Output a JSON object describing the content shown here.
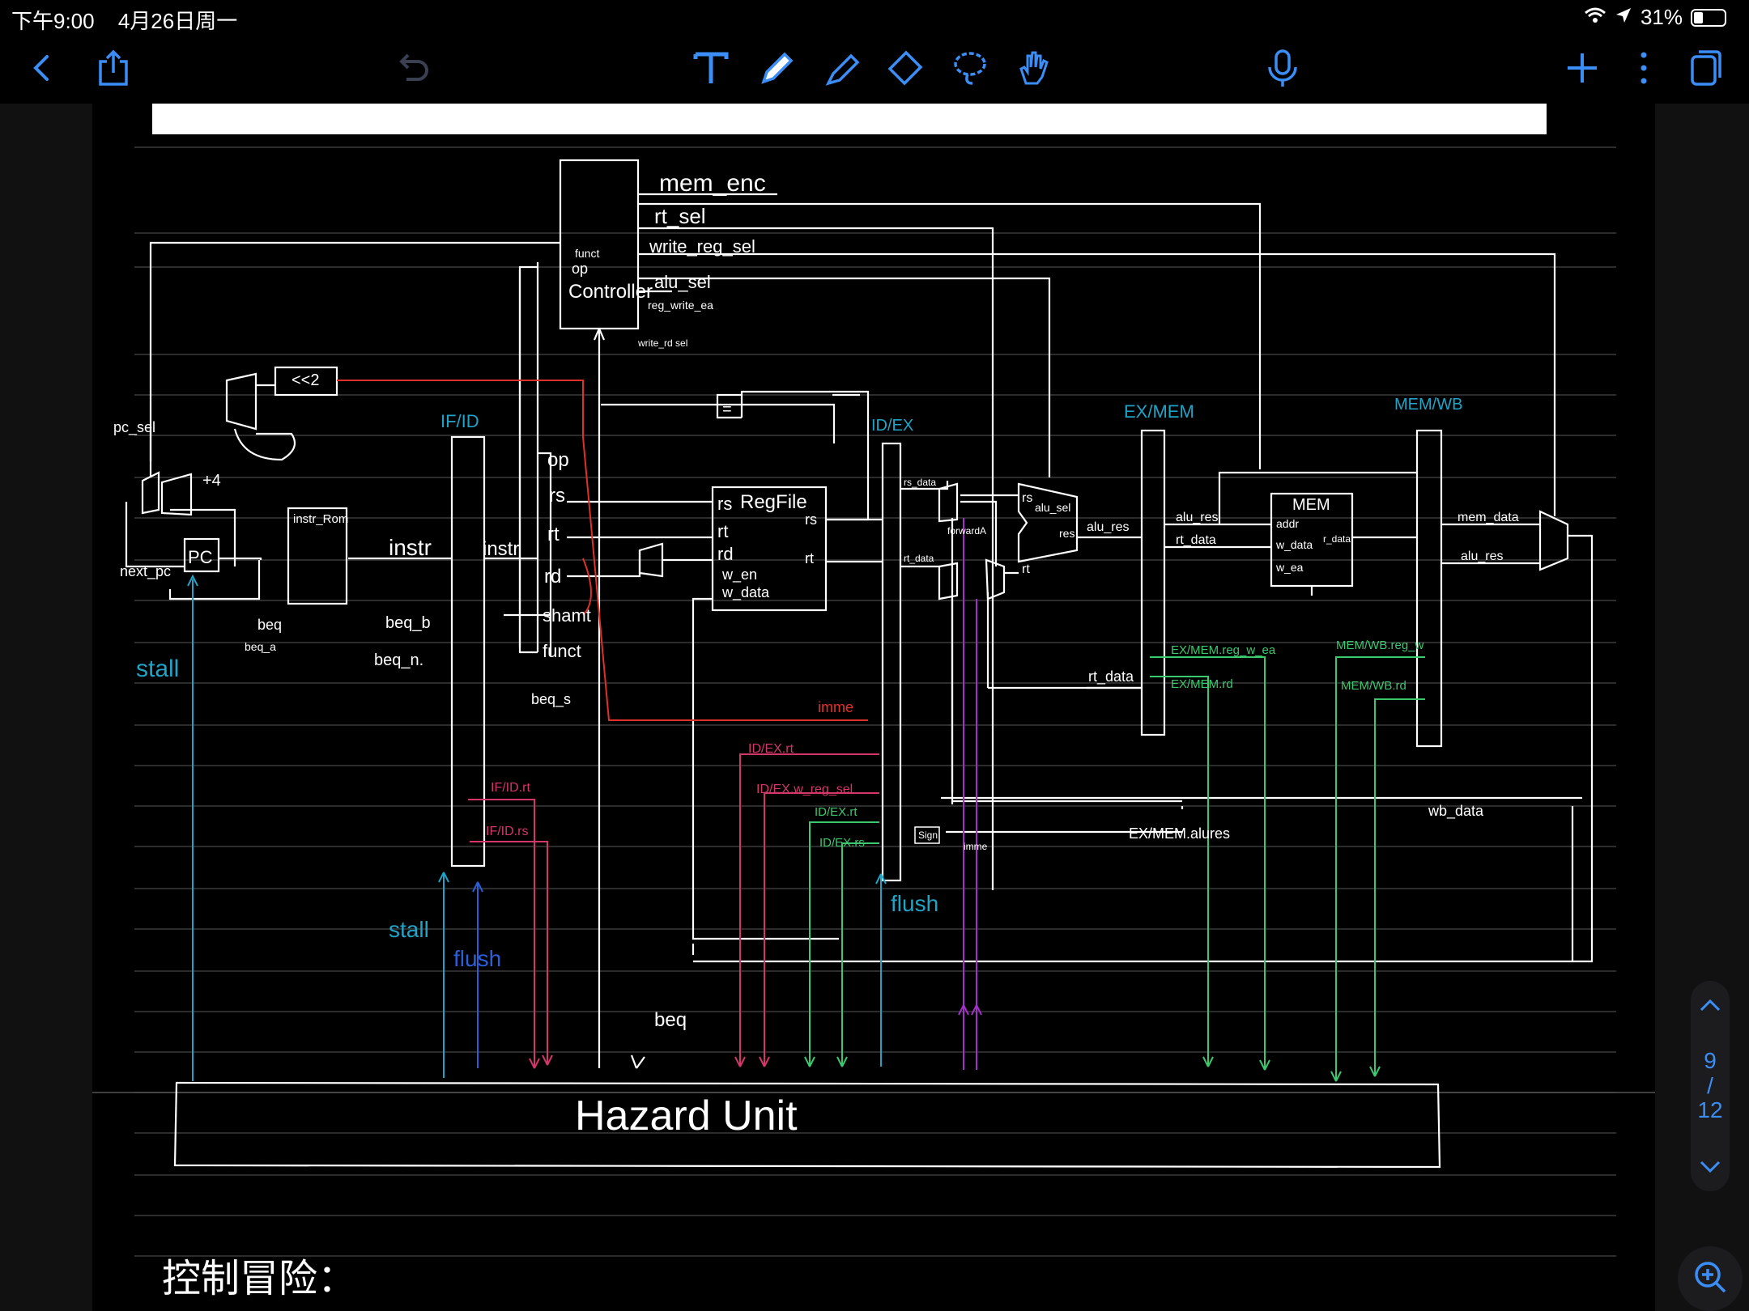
{
  "status": {
    "time": "下午9:00",
    "date": "4月26日周一",
    "battery": "31%",
    "battery_level": 0.31
  },
  "toolbar": {
    "icons": [
      "back-icon",
      "share-icon",
      "undo-icon",
      "text-tool-icon",
      "pen-icon",
      "highlighter-icon",
      "eraser-icon",
      "lasso-icon",
      "hand-icon",
      "mic-icon",
      "add-icon",
      "more-icon",
      "pages-icon"
    ]
  },
  "pager": {
    "current": "9",
    "sep": "/",
    "total": "12"
  },
  "colors": {
    "ink": "#ffffff",
    "cyan": "#1fa3c6",
    "red": "#e0302a",
    "pink": "#d2366b",
    "green": "#3cc86e",
    "purple": "#a330c8",
    "blue": "#2a5fd8",
    "accent": "#3a8ef6"
  },
  "diagram": {
    "controller": [
      "funct",
      "op",
      "Controller"
    ],
    "ctrl_signals": [
      "mem_enc",
      "rt_sel",
      "write_reg_sel",
      "alu_sel",
      "reg_write_ea",
      "write_rd sel"
    ],
    "shift": "<<2",
    "plus4": "+4",
    "pc_sel": "pc_sel",
    "next_pc": "next_pc",
    "pc": "PC",
    "instr_rom": "instr_Rom",
    "instr1": "instr",
    "instr2": "instr",
    "beq_labels": [
      "beq",
      "beq_a",
      "beq_b",
      "beq_n.",
      "beq_s"
    ],
    "if_id": "IF/ID",
    "id_ex": "ID/EX",
    "ex_mem": "EX/MEM",
    "mem_wb": "MEM/WB",
    "fields": [
      "op",
      "rs",
      "rt",
      "rd",
      "shamt",
      "funct"
    ],
    "regfile": [
      "rs",
      "RegFile",
      "rt",
      "rd",
      "w_en",
      "w_data"
    ],
    "regfile_out": [
      "rs",
      "rt"
    ],
    "eq": "=",
    "rs_data": "rs_data",
    "rt_data": "rt_data",
    "forwardA": "forwardA",
    "alu_sel": "alu_sel",
    "alu_in": [
      "rs",
      "rt"
    ],
    "alu_res_out": "res",
    "alu_res": "alu_res",
    "alu_res2": "alu_res",
    "rt_data2": "rt_data",
    "rt_data3": "rt_data",
    "mem_block": [
      "MEM",
      "addr",
      "w_data",
      "r_data",
      "w_ea"
    ],
    "mem_data": "mem_data",
    "alu_res3": "alu_res",
    "wb_data": "wb_data",
    "imme": "imme",
    "imme2": "imme",
    "sign": "Sign",
    "ex_mem_alures": "EX/MEM.alures",
    "pink_labels": [
      "IF/ID.rt",
      "IF/ID.rs",
      "ID/EX.rt",
      "ID/EX.w_reg_sel"
    ],
    "green_labels": [
      "ID/EX.rt",
      "ID/EX.rs",
      "EX/MEM.reg_w_ea",
      "EX/MEM.rd",
      "MEM/WB.reg_w",
      "MEM/WB.rd"
    ],
    "stall1": "stall",
    "stall2": "stall",
    "flush1": "flush",
    "flush2": "flush",
    "beq_bottom": "beq",
    "hazard": "Hazard      Unit",
    "note": "控制冒险："
  }
}
